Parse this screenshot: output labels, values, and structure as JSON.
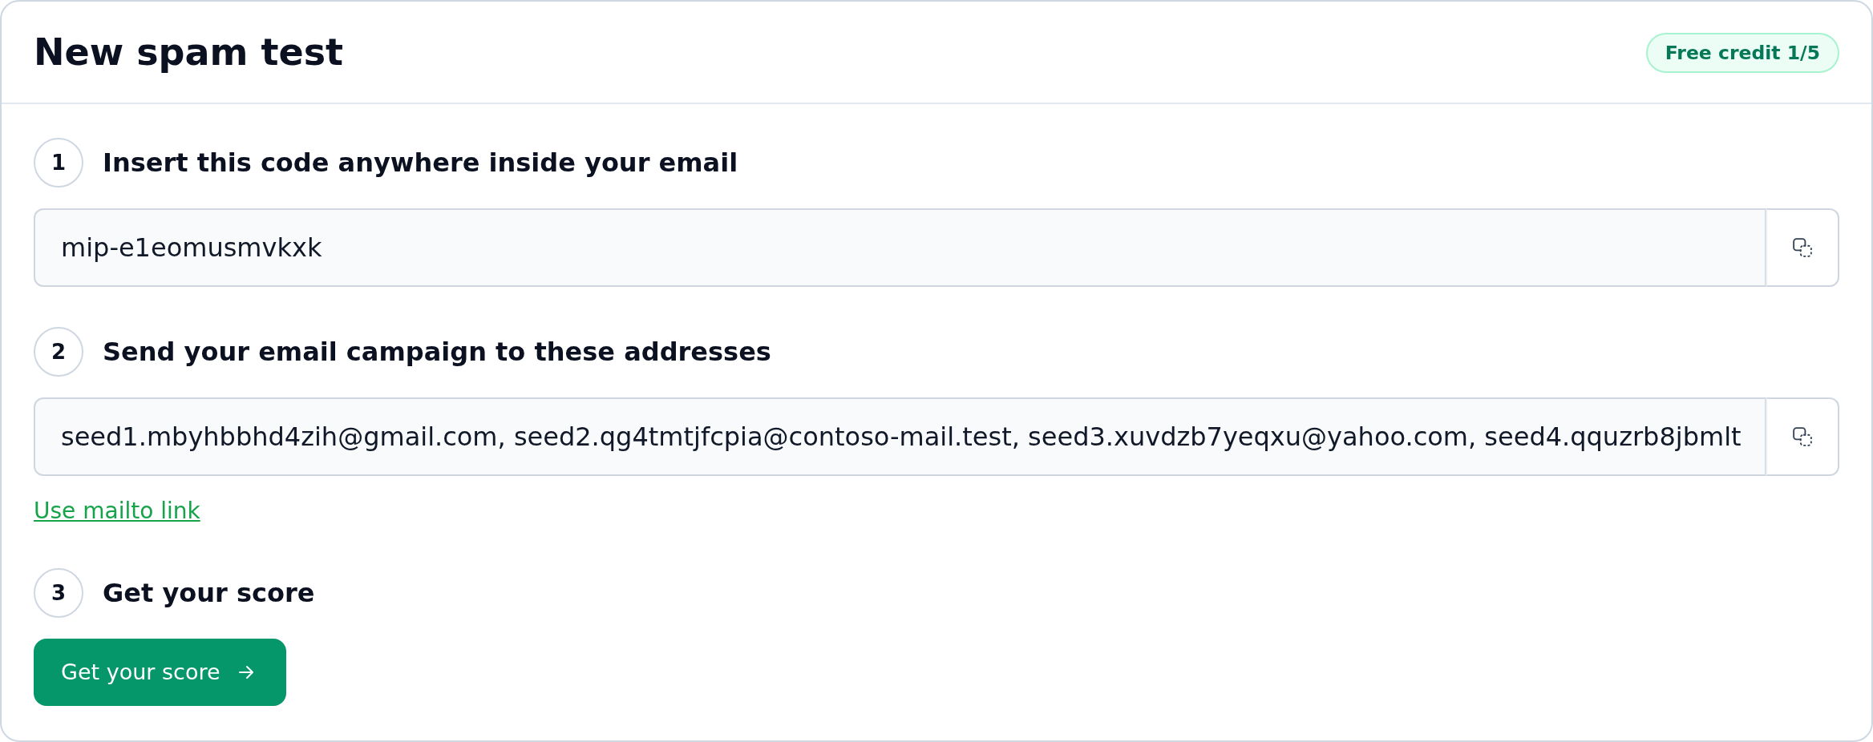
{
  "header": {
    "title": "New spam test",
    "badge": "Free credit 1/5"
  },
  "steps": [
    {
      "number": "1",
      "title": "Insert this code anywhere inside your email",
      "kind": "field",
      "field": {
        "value": "mip-e1eomusmvkxk"
      }
    },
    {
      "number": "2",
      "title": "Send your email campaign to these addresses",
      "kind": "field",
      "field": {
        "value": "seed1.mbyhbbhd4zih@gmail.com, seed2.qg4tmtjfcpia@contoso-mail.test, seed3.xuvdzb7yeqxu@yahoo.com, seed4.qquzrb8jbmlt"
      },
      "link": "Use mailto link"
    },
    {
      "number": "3",
      "title": "Get your score",
      "kind": "button",
      "button": "Get your score"
    }
  ]
}
